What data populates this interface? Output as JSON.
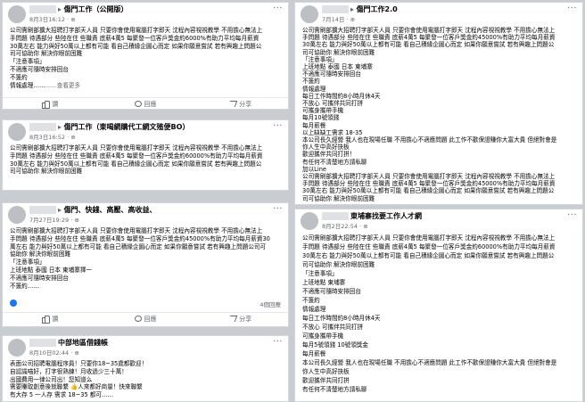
{
  "ui": {
    "more_glyph": "···",
    "see_more": "……查看更多"
  },
  "posts": [
    {
      "group": "傷門工作（公開版）",
      "meta": "8月3日16:12 · ⊕",
      "lines": [
        "公司需刷部擴大招聘打字部天人員 只要你會使用電腦打字即天 沈程內容視視教學 不用擔心無法上",
        "手問題 待遇部分 些陸在住 些職責 底薪4萬5 每聚發一位客戶獎金約6000%有助力平均每月薪資",
        "30萬左右 能力與好50萬以上都有可能 看自己積緣企圖心而定 如果你願意嘗試 若有興趣上問題公",
        "司可協助你 解決你眼前困難",
        "「注意事項」",
        "不適應可隨時安排回台",
        "不簽約",
        "情報處理……"
      ],
      "see_more": true,
      "actions": [
        "讚",
        "回應",
        "分享"
      ]
    },
    {
      "group": "傷門工作（東喝網購代工網文殖便BO）",
      "meta": "8月3日16:52 · ⊕",
      "lines": [
        "公司需刷部擴大招聘打字部天人員 只要你會使用電腦打字即天 沈程內容視視教學 不用擔心無法上",
        "手問題 待遇部分 些陸在住 些職責 底薪4萬5 每聚發一位客戶獎金約60000%有助力平均每月薪資",
        "30萬左右 能力與好50萬以上都有可能 看自己積緣企圖心而定 如果你願意嘗試 若有興趣上問題公",
        "司可協助你 解決你眼前困難"
      ],
      "see_more": false,
      "actions": []
    },
    {
      "group": "傷門、快錢、高壓、高收益、",
      "meta": "7月27日19:29 · ⊕",
      "lines": [
        "公司需刷部擴大招聘打字部天人員 只要你會使用電腦打字即天 沈程內容視視教學 不用擔心無法上",
        "手問題 待遇部分 些陸在住 些職責 底薪4萬5 每聚發一位客戶獎金約45000%有助力平均每月薪資30",
        "萬左右 能力與好50萬以上都有可能 看自己積緣企圖心而定 如果你願意嘗試 若有興趣上問題公司可",
        "協助你 解決你眼前困難",
        "「注意事項」",
        "上班地點 泰國 日本 東埔寨擇一",
        "不適應可隨時安排回台",
        "不簽約……"
      ],
      "see_more": true,
      "reaction_count": "4個回應",
      "actions": [
        "讚",
        "回應",
        "分享"
      ]
    },
    {
      "group": "中部地區借錢帳",
      "meta": "8月10日02:44 · ⊕",
      "lines": [
        "表面公司招聘電腦程序員！只要你18~35歲都歡迎！",
        "自認識喵好，打字很熟練！月收過少三十萬！",
        "出國費用一律公司出！您知道么",
        "需要賺取創意後就聯繫 👍人來都好商量！快來聯繫",
        "有大存 5 一人存 需求 18~35 都可……"
      ],
      "see_more": false,
      "actions": []
    },
    {
      "group": "傷門工作2.0",
      "meta": "7月14日 · ⊕",
      "lines": [
        "公司需刷部擴大招聘打字部天人員 只要你會使用電腦打字即天 沈程內容視視教學 不用擔心無法上",
        "手問題 待遇部分 些陸在住 些職責 底薪4萬5 每聚發一位客戶獎金約45000%有助力平均每月薪資",
        "30萬左右 能力與好50萬以上都有可能 看自己積緣企圖心而定 如果你願意嘗試 若有興趣上問題公",
        "司可協助你 解決你眼前困難",
        "「注意事項」",
        "上班地點 泰國 日本 東埔寨",
        "不適應可隨時安排回台",
        "不簽約",
        "情報處理",
        "每日工作時間約8小時月休4天",
        "不放心 可攜伴共同打拼",
        "可攜身攜帶手機",
        "每月10號領錢",
        "每月薪餐",
        "以上缺缺工需求 18-35",
        "本公司長久經營 我人也在現場任職 不用擔心不適應問題 此工作不歡保證賺你大富大貴 但絕對會是",
        "你人生中高好抉板",
        "歡迎攜伴共同打拼！",
        "有任何不清楚地方請私聊",
        "加以Line",
        "公司需刷部擴大招聘打字部天人員 只要你會使用電腦打字即天 沈程內容視視教學 不用擔心無法上",
        "手問題 待遇部分 些陸在住 些職責 底薪4萬5 每聚發一位客戶獎金約45000%有助力平均每月薪資",
        "30萬左右 能力與好50萬以上都有可能 看自己積緣企圖心而定 如果你願意嘗試 若有興趣上問題公",
        "司可協助你 解決你眼前困難"
      ],
      "see_more": false,
      "actions": []
    },
    {
      "group": "東埔寨找要工作人才網",
      "meta": "8月2日22:54 · ⊕",
      "lines": [
        "公司需刷部擴大招聘打字部天人員 只要你會使用電腦打字即天 沈程內容視視教學 不用擔心無法上",
        "手問題 待遇部分 些陸在住 些職責 底薪4萬5 每聚發一位客戶獎金約60000%有助力平均每月薪資",
        "30萬左右 能力與好50萬以上都有可能 看自己積緣企圖心而定 如果你願意嘗試 若有興趣上問題公",
        "司可協助你 解決你眼前困難",
        "「注意事項」",
        "上班地點 東埔寨",
        "不適應可隨時安排回台",
        "不簽約",
        "情報處理",
        "每日工作時間約8小時月休4天",
        "不放心 可攜伴共同打拼",
        "可攜身攜帶手機",
        "每月5號領錢 10號領獎金",
        "每月薪餐",
        "本公司長久經營 我人也在現場任職 不用擔心不適應問題 此工作不歡保證賺你大富大貴 但絕對會是",
        "你人生中高好抉板",
        "歡迎攜伴共同打拼",
        "有任何不清楚地方請私聊"
      ],
      "see_more": false,
      "actions": []
    }
  ]
}
